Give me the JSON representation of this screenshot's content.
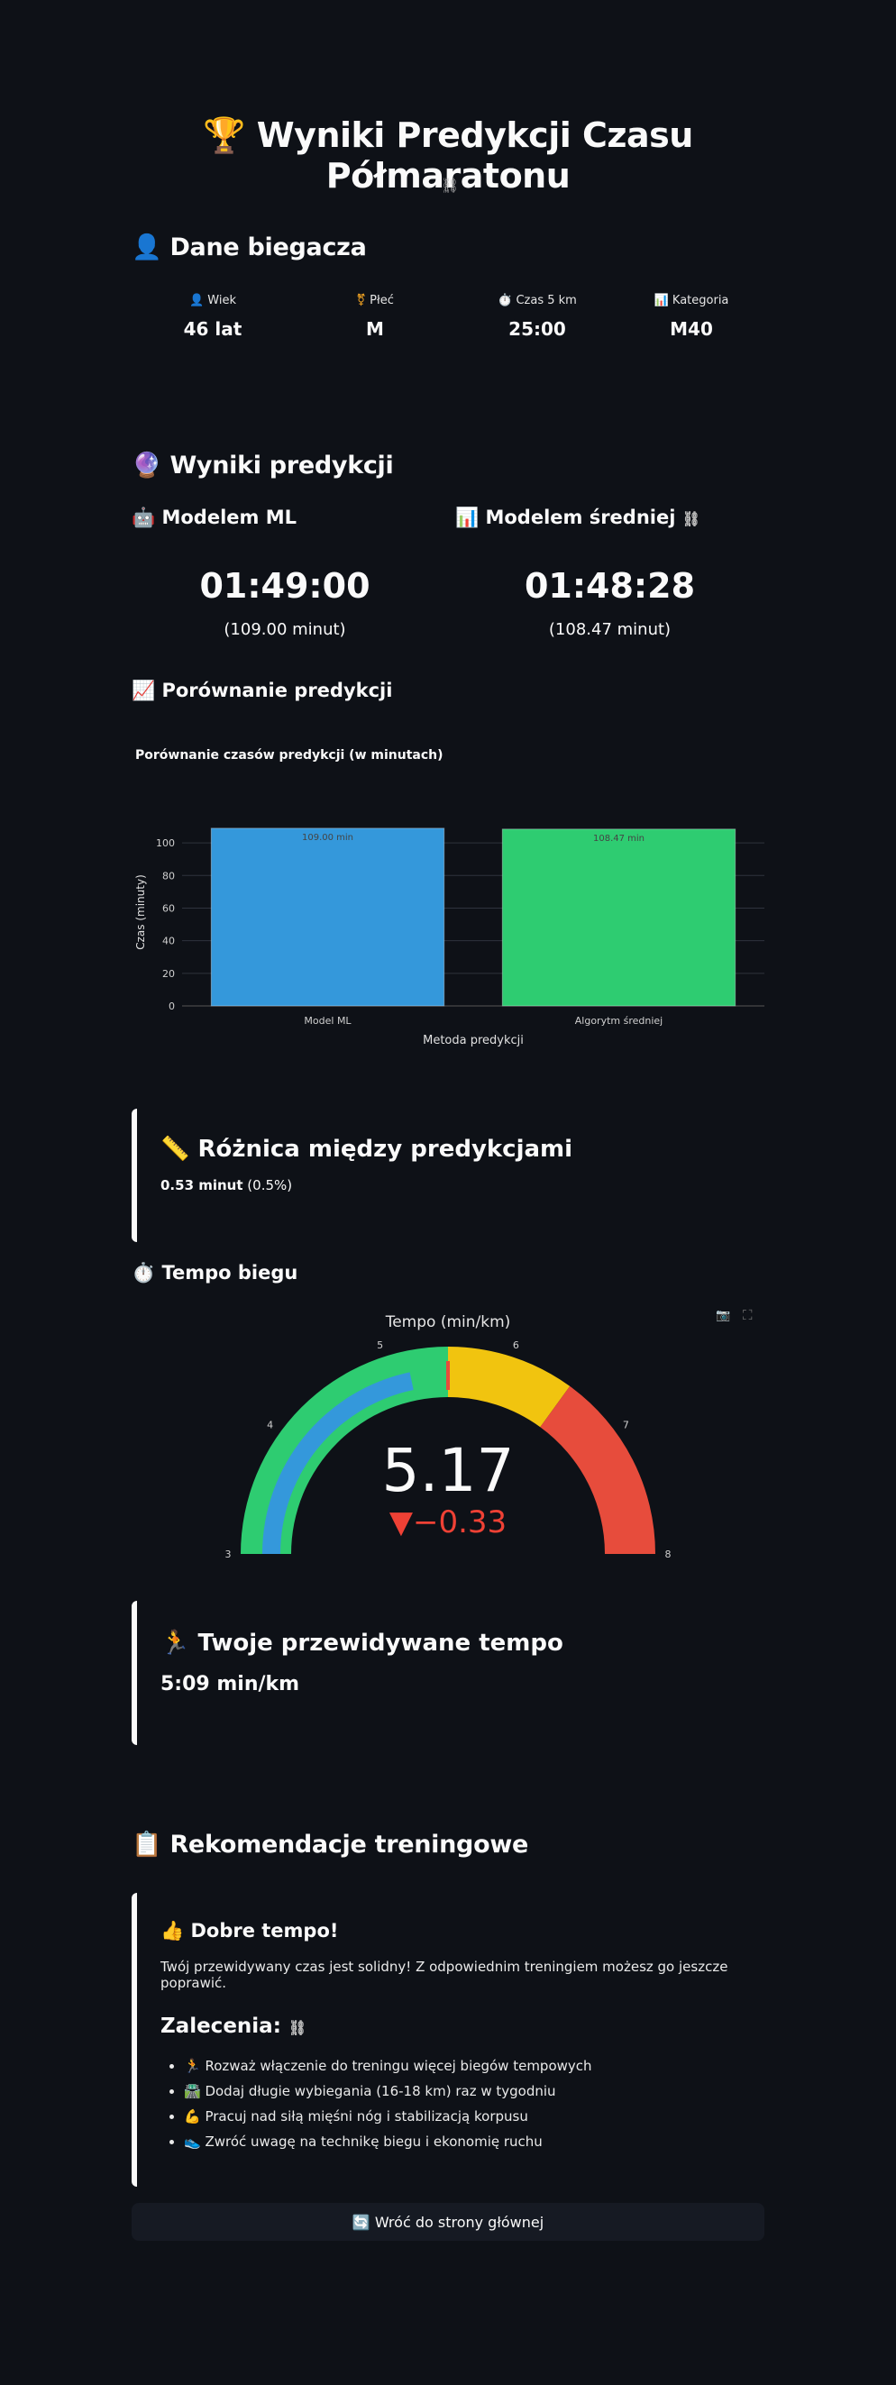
{
  "page": {
    "title_icon": "🏆",
    "title": "Wyniki Predykcji Czasu Półmaratonu",
    "link_icon": "⛓"
  },
  "runner": {
    "heading_icon": "👤",
    "heading": "Dane biegacza",
    "metrics": [
      {
        "icon": "👤",
        "label": "Wiek",
        "value": "46 lat"
      },
      {
        "icon": "⚧",
        "label": "Płeć",
        "value": "M"
      },
      {
        "icon": "⏱️",
        "label": "Czas 5 km",
        "value": "25:00"
      },
      {
        "icon": "📊",
        "label": "Kategoria",
        "value": "M40"
      }
    ]
  },
  "prediction": {
    "heading_icon": "🔮",
    "heading": "Wyniki predykcji",
    "ml": {
      "icon": "🤖",
      "title": "Modelem ML",
      "time": "01:49:00",
      "minutes": "(109.00 minut)"
    },
    "avg": {
      "icon": "📊",
      "title": "Modelem średniej",
      "time": "01:48:28",
      "minutes": "(108.47 minut)"
    }
  },
  "comparison": {
    "heading_icon": "📈",
    "heading": "Porównanie predykcji"
  },
  "chart_data": {
    "type": "bar",
    "title": "Porównanie czasów predykcji (w minutach)",
    "categories": [
      "Model ML",
      "Algorytm średniej"
    ],
    "values": [
      109.0,
      108.47
    ],
    "data_labels": [
      "109.00 min",
      "108.47 min"
    ],
    "colors": [
      "#3498db",
      "#2ecc71"
    ],
    "xlabel": "Metoda predykcji",
    "ylabel": "Czas (minuty)",
    "ylim": [
      0,
      115
    ],
    "yticks": [
      0,
      20,
      40,
      60,
      80,
      100
    ],
    "grid": true
  },
  "difference": {
    "icon": "📏",
    "heading": "Różnica między predykcjami",
    "value_bold": "0.53 minut",
    "value_rest": " (0.5%)"
  },
  "pace": {
    "heading_icon": "⏱️",
    "heading": "Tempo biegu",
    "gauge": {
      "title": "Tempo (min/km)",
      "value": 5.17,
      "value_text": "5.17",
      "delta_text": "▼−0.33",
      "min": 3,
      "max": 8,
      "threshold": 5.5,
      "ticks": [
        "3",
        "4",
        "5",
        "6",
        "7",
        "8"
      ],
      "steps": [
        {
          "from": 3,
          "to": 5.5,
          "color": "#2ecc71"
        },
        {
          "from": 5.5,
          "to": 6.5,
          "color": "#f1c40f"
        },
        {
          "from": 6.5,
          "to": 8,
          "color": "#e74c3c"
        }
      ],
      "bar_color": "#3498db",
      "threshold_color": "#e74c3c",
      "delta_color": "#ef4135"
    },
    "toolbar": {
      "camera": "📷",
      "fullscreen": "⛶"
    }
  },
  "your_pace": {
    "icon": "🏃",
    "heading": "Twoje przewidywane tempo",
    "value": "5:09 min/km"
  },
  "recommendations": {
    "heading_icon": "📋",
    "heading": "Rekomendacje treningowe",
    "good_icon": "👍",
    "good_title": "Dobre tempo!",
    "text": "Twój przewidywany czas jest solidny! Z odpowiednim treningiem możesz go jeszcze poprawić.",
    "subheading": "Zalecenia:",
    "items": [
      "🏃 Rozważ włączenie do treningu więcej biegów tempowych",
      "🛣️ Dodaj długie wybiegania (16-18 km) raz w tygodniu",
      "💪 Pracuj nad siłą mięśni nóg i stabilizacją korpusu",
      "👟 Zwróć uwagę na technikę biegu i ekonomię ruchu"
    ]
  },
  "back_button": {
    "icon": "🔄",
    "label": "Wróć do strony głównej"
  }
}
